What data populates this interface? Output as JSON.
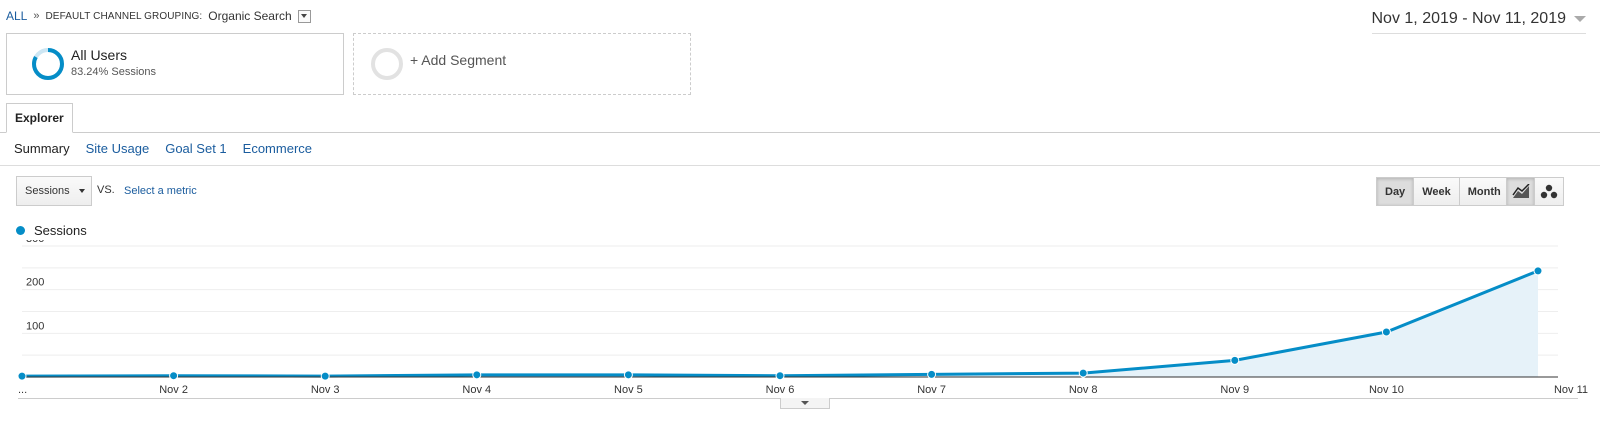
{
  "breadcrumb": {
    "all_label": "ALL",
    "separator": "»",
    "dimension": "DEFAULT CHANNEL GROUPING:",
    "value": "Organic Search"
  },
  "date_range": "Nov 1, 2019 - Nov 11, 2019",
  "segments": {
    "all_users": {
      "title": "All Users",
      "subtitle": "83.24% Sessions",
      "ring_color": "#058dc7",
      "ring_percent": 83.24
    },
    "add_segment": {
      "label": "+ Add Segment"
    }
  },
  "tabs": {
    "explorer": "Explorer"
  },
  "subtabs": [
    "Summary",
    "Site Usage",
    "Goal Set 1",
    "Ecommerce"
  ],
  "controls": {
    "metric": "Sessions",
    "vs": "VS.",
    "select_metric": "Select a metric",
    "ranges": [
      "Day",
      "Week",
      "Month"
    ],
    "active_range": "Day",
    "chart_types": [
      "line-chart-icon",
      "motion-chart-icon"
    ]
  },
  "colors": {
    "series": "#058dc7",
    "area": "#e6f2f9",
    "link": "#1a5c9e"
  },
  "chart_data": {
    "type": "area",
    "categories": [
      "...",
      "Nov 2",
      "Nov 3",
      "Nov 4",
      "Nov 5",
      "Nov 6",
      "Nov 7",
      "Nov 8",
      "Nov 9",
      "Nov 10",
      "Nov 11"
    ],
    "series": [
      {
        "name": "Sessions",
        "values": [
          2,
          3,
          2,
          5,
          5,
          3,
          6,
          9,
          38,
          103,
          243
        ]
      }
    ],
    "ylim": [
      0,
      300
    ],
    "yticks": [
      100,
      200,
      300
    ],
    "grid": true,
    "legend": "top-left"
  }
}
